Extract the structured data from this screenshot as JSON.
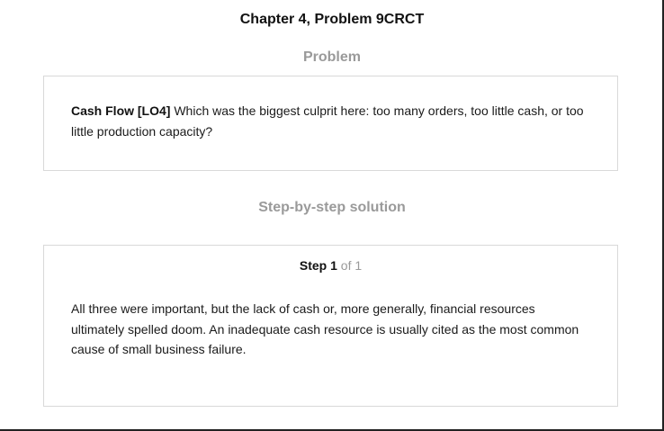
{
  "page": {
    "title": "Chapter 4, Problem 9CRCT"
  },
  "problem": {
    "heading": "Problem",
    "label": "Cash Flow [LO4]",
    "text": " Which was the biggest culprit here: too many orders, too little cash, or too little production capacity?"
  },
  "solution": {
    "heading": "Step-by-step solution",
    "step_label": "Step",
    "step_number": "1",
    "step_total_text": " of 1",
    "text": "All three were important, but the lack of cash or, more generally, financial resources ultimately spelled doom. An inadequate cash resource is usually cited as the most common cause of small business failure."
  },
  "colors": {
    "heading_gray": "#9a9a9a",
    "card_border": "#d9d9d9",
    "text": "#1a1a1a"
  }
}
